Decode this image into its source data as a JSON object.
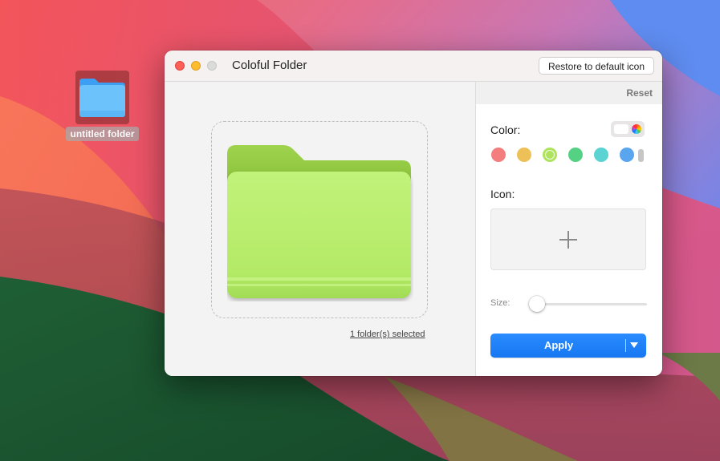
{
  "desktop": {
    "folder_label": "untitled folder"
  },
  "window": {
    "title": "Coloful Folder",
    "restore_label": "Restore to default icon",
    "status_link": "1 folder(s) selected",
    "preview_folder_color": "#b5ec6a"
  },
  "sidebar": {
    "reset_label": "Reset",
    "color_label": "Color:",
    "swatches": [
      {
        "name": "red",
        "hex": "#f47d7d"
      },
      {
        "name": "yellow",
        "hex": "#edc157",
        "selected": false
      },
      {
        "name": "lime",
        "hex": "#aee360",
        "selected": true
      },
      {
        "name": "green",
        "hex": "#55d184"
      },
      {
        "name": "teal",
        "hex": "#5cd3d3"
      },
      {
        "name": "blue",
        "hex": "#5aa6ee"
      }
    ],
    "icon_label": "Icon:",
    "size_label": "Size:",
    "size_value": 0,
    "apply_label": "Apply"
  },
  "colors": {
    "accent": "#1a7cf5"
  }
}
